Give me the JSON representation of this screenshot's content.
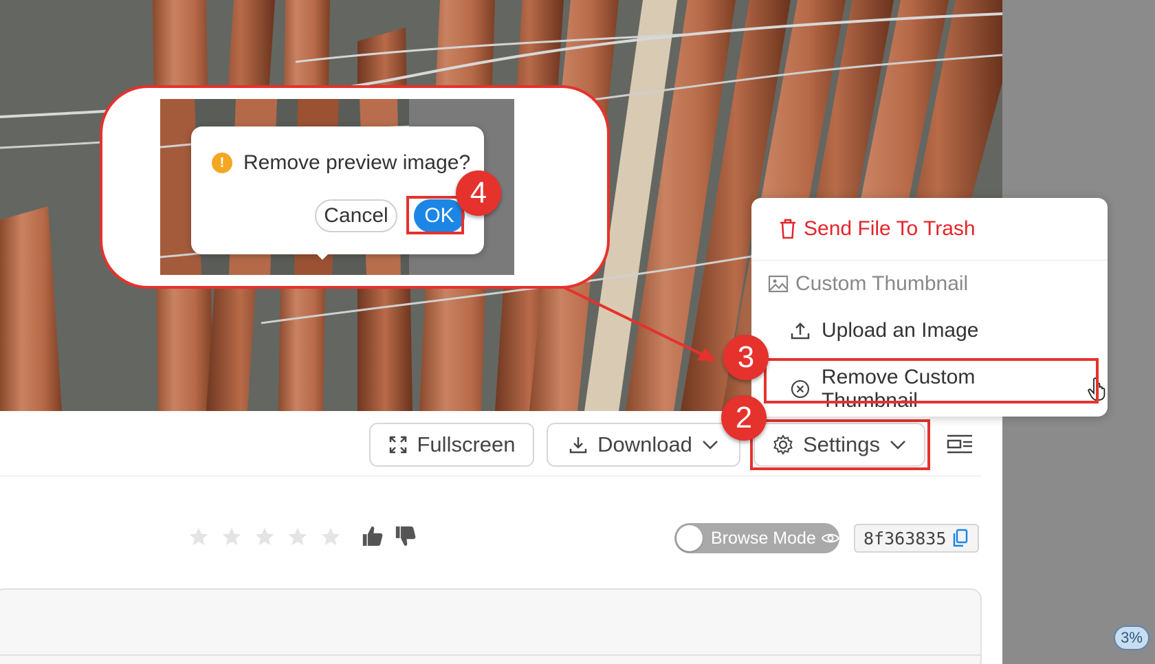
{
  "toolbar": {
    "fullscreen_label": "Fullscreen",
    "download_label": "Download",
    "settings_label": "Settings"
  },
  "settings_menu": {
    "send_to_trash": "Send File To Trash",
    "section_title": "Custom Thumbnail",
    "upload_image": "Upload an Image",
    "remove_thumbnail": "Remove Custom Thumbnail"
  },
  "confirm_dialog": {
    "message": "Remove preview image?",
    "cancel_label": "Cancel",
    "ok_label": "OK"
  },
  "rating": {
    "stars_total": 5,
    "stars_filled": 0
  },
  "browse_mode": {
    "label": "Browse Mode",
    "enabled": false
  },
  "file_hash": "8f363835",
  "percent_badge": "3%",
  "steps": {
    "step2": "2",
    "step3": "3",
    "step4": "4"
  },
  "colors": {
    "accent_red": "#e5322d",
    "primary_blue": "#1c86e6",
    "warning_orange": "#f5a623",
    "trash_red": "#e5242b"
  },
  "icons": [
    "expand-icon",
    "download-icon",
    "gear-icon",
    "chevron-down-icon",
    "list-view-icon",
    "star-icon",
    "thumbs-up-icon",
    "thumbs-down-icon",
    "eye-icon",
    "copy-icon",
    "trash-icon",
    "image-icon",
    "upload-icon",
    "circle-x-icon",
    "hand-cursor-icon",
    "warning-icon"
  ]
}
